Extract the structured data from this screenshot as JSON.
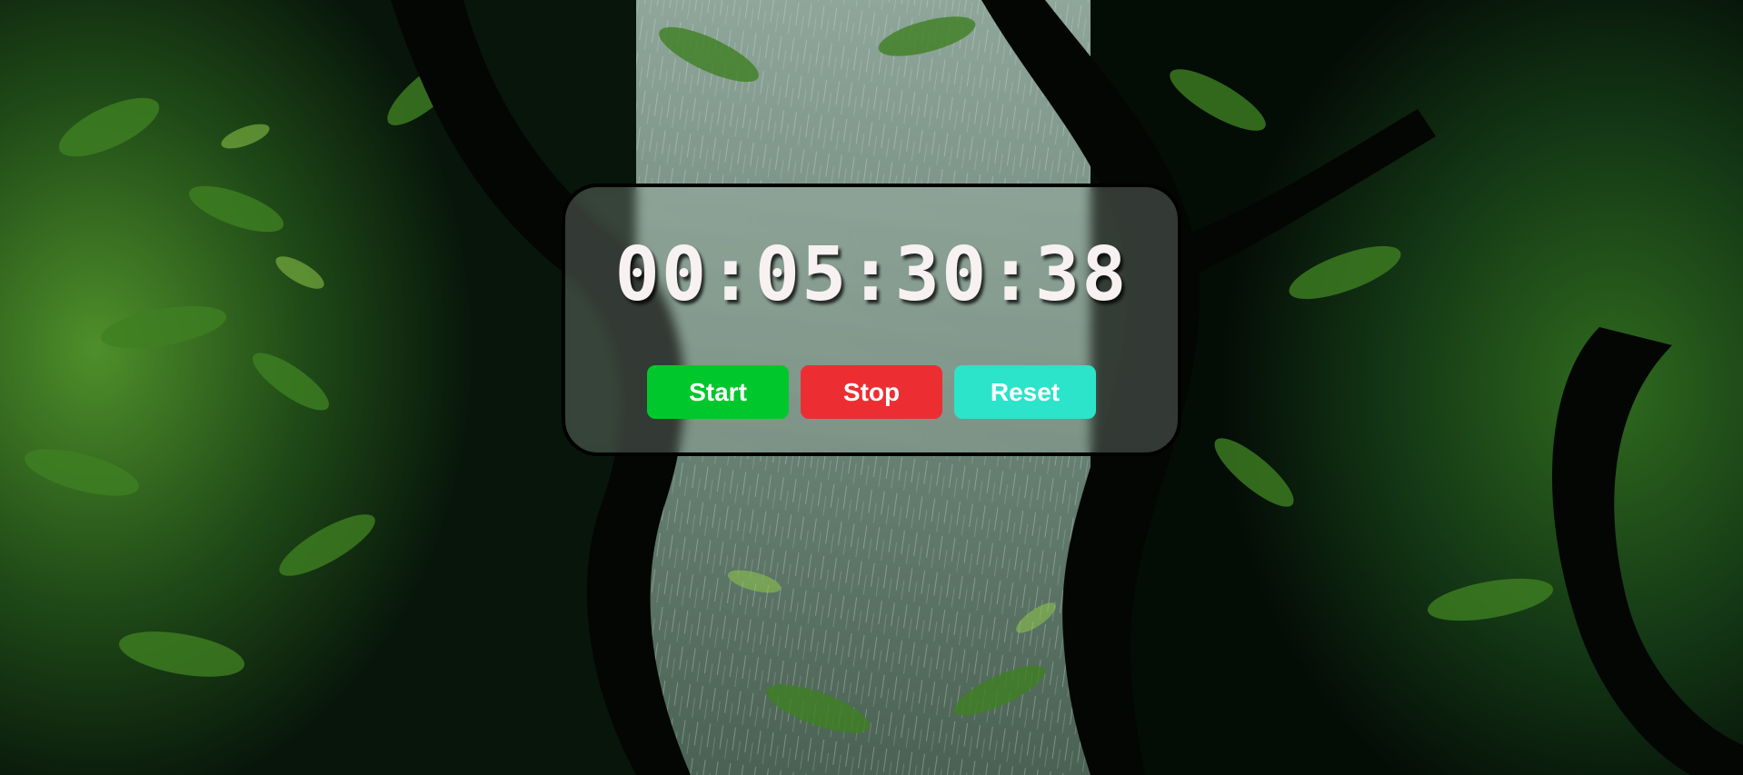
{
  "timer": {
    "display": "00:05:30:38"
  },
  "controls": {
    "start_label": "Start",
    "stop_label": "Stop",
    "reset_label": "Reset"
  },
  "colors": {
    "start": "#00c82c",
    "stop": "#ec2e33",
    "reset": "#2be4c9",
    "panel_border": "#000000",
    "time_text": "#f7f1f2"
  }
}
